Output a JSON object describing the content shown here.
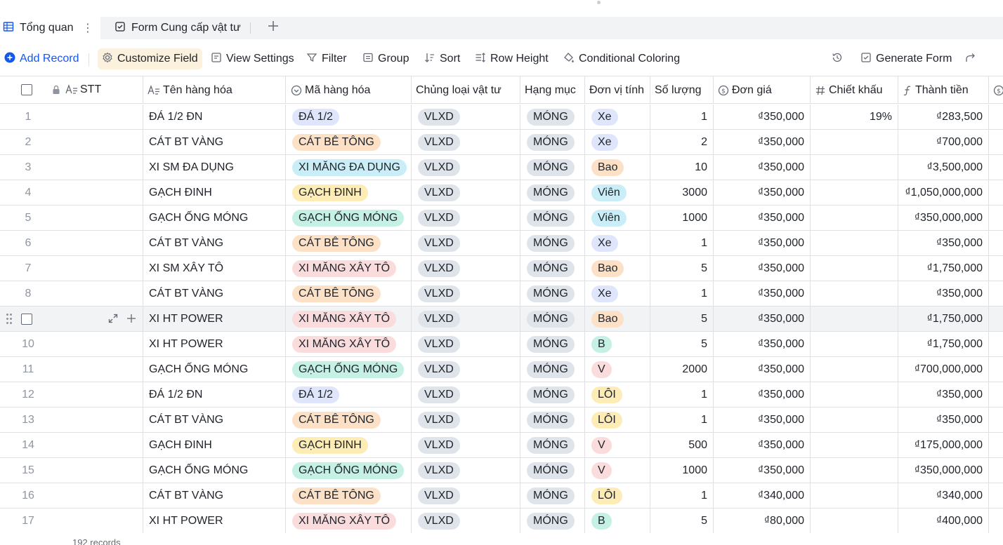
{
  "tabs": {
    "active_label": "Tổng quan",
    "second_label": "Form Cung cấp vật tư"
  },
  "toolbar": {
    "add_record": "Add Record",
    "customize_field": "Customize Field",
    "view_settings": "View Settings",
    "filter": "Filter",
    "group": "Group",
    "sort": "Sort",
    "row_height": "Row Height",
    "conditional_coloring": "Conditional Coloring",
    "generate_form": "Generate Form"
  },
  "columns": {
    "stt": "STT",
    "ten_hang_hoa": "Tên hàng hóa",
    "ma_hang_hoa": "Mã hàng hóa",
    "chung_loai": "Chủng loại vật tư",
    "hang_muc": "Hạng mục",
    "don_vi_tinh": "Đơn vị tính",
    "so_luong": "Số lượng",
    "don_gia": "Đơn giá",
    "chiet_khau": "Chiết khấu",
    "thanh_tien": "Thành tiền"
  },
  "tag_colors": {
    "ĐÁ 1/2": "#dfe6fb",
    "CÁT BÊ TÔNG": "#fde1c7",
    "XI MĂNG ĐA DỤNG": "#c9eef7",
    "GẠCH ĐINH": "#fdecb5",
    "GẠCH ỐNG MÓNG": "#c5f0e4",
    "XI MĂNG XÂY TÔ": "#fbdcdc",
    "VLXD": "#dfe3ea",
    "MÓNG": "#dfe3ea",
    "Xe": "#dfe6fb",
    "Bao": "#fde1c7",
    "Viên": "#c9eef7",
    "B": "#c5f0e4",
    "V": "#fbdcdc",
    "LÔI": "#fdecb5"
  },
  "rows": [
    {
      "idx": "1",
      "ten": "ĐÁ 1/2 ĐN",
      "ma": "ĐÁ 1/2",
      "loai": "VLXD",
      "hang_muc": "MÓNG",
      "dvt": "Xe",
      "sl": "1",
      "don_gia": "₫350,000",
      "ck": "19%",
      "thanh_tien": "₫283,500"
    },
    {
      "idx": "2",
      "ten": "CÁT BT VÀNG",
      "ma": "CÁT BÊ TÔNG",
      "loai": "VLXD",
      "hang_muc": "MÓNG",
      "dvt": "Xe",
      "sl": "2",
      "don_gia": "₫350,000",
      "ck": "",
      "thanh_tien": "₫700,000"
    },
    {
      "idx": "3",
      "ten": "XI SM ĐA DỤNG",
      "ma": "XI MĂNG ĐA DỤNG",
      "loai": "VLXD",
      "hang_muc": "MÓNG",
      "dvt": "Bao",
      "sl": "10",
      "don_gia": "₫350,000",
      "ck": "",
      "thanh_tien": "₫3,500,000"
    },
    {
      "idx": "4",
      "ten": "GẠCH ĐINH",
      "ma": "GẠCH ĐINH",
      "loai": "VLXD",
      "hang_muc": "MÓNG",
      "dvt": "Viên",
      "sl": "3000",
      "don_gia": "₫350,000",
      "ck": "",
      "thanh_tien": "₫1,050,000,000"
    },
    {
      "idx": "5",
      "ten": "GẠCH ỐNG MÓNG",
      "ma": "GẠCH ỐNG MÓNG",
      "loai": "VLXD",
      "hang_muc": "MÓNG",
      "dvt": "Viên",
      "sl": "1000",
      "don_gia": "₫350,000",
      "ck": "",
      "thanh_tien": "₫350,000,000"
    },
    {
      "idx": "6",
      "ten": "CÁT BT VÀNG",
      "ma": "CÁT BÊ TÔNG",
      "loai": "VLXD",
      "hang_muc": "MÓNG",
      "dvt": "Xe",
      "sl": "1",
      "don_gia": "₫350,000",
      "ck": "",
      "thanh_tien": "₫350,000"
    },
    {
      "idx": "7",
      "ten": "XI SM XÂY TÔ",
      "ma": "XI MĂNG XÂY TÔ",
      "loai": "VLXD",
      "hang_muc": "MÓNG",
      "dvt": "Bao",
      "sl": "5",
      "don_gia": "₫350,000",
      "ck": "",
      "thanh_tien": "₫1,750,000"
    },
    {
      "idx": "8",
      "ten": "CÁT BT VÀNG",
      "ma": "CÁT BÊ TÔNG",
      "loai": "VLXD",
      "hang_muc": "MÓNG",
      "dvt": "Xe",
      "sl": "1",
      "don_gia": "₫350,000",
      "ck": "",
      "thanh_tien": "₫350,000"
    },
    {
      "idx": "",
      "ten": "XI HT POWER",
      "ma": "XI MĂNG XÂY TÔ",
      "loai": "VLXD",
      "hang_muc": "MÓNG",
      "dvt": "Bao",
      "sl": "5",
      "don_gia": "₫350,000",
      "ck": "",
      "thanh_tien": "₫1,750,000",
      "hover": true
    },
    {
      "idx": "10",
      "ten": "XI HT POWER",
      "ma": "XI MĂNG XÂY TÔ",
      "loai": "VLXD",
      "hang_muc": "MÓNG",
      "dvt": "B",
      "sl": "5",
      "don_gia": "₫350,000",
      "ck": "",
      "thanh_tien": "₫1,750,000"
    },
    {
      "idx": "11",
      "ten": "GẠCH ỐNG MÓNG",
      "ma": "GẠCH ỐNG MÓNG",
      "loai": "VLXD",
      "hang_muc": "MÓNG",
      "dvt": "V",
      "sl": "2000",
      "don_gia": "₫350,000",
      "ck": "",
      "thanh_tien": "₫700,000,000"
    },
    {
      "idx": "12",
      "ten": "ĐÁ 1/2 ĐN",
      "ma": "ĐÁ 1/2",
      "loai": "VLXD",
      "hang_muc": "MÓNG",
      "dvt": "LÔI",
      "sl": "1",
      "don_gia": "₫350,000",
      "ck": "",
      "thanh_tien": "₫350,000"
    },
    {
      "idx": "13",
      "ten": "CÁT BT VÀNG",
      "ma": "CÁT BÊ TÔNG",
      "loai": "VLXD",
      "hang_muc": "MÓNG",
      "dvt": "LÔI",
      "sl": "1",
      "don_gia": "₫350,000",
      "ck": "",
      "thanh_tien": "₫350,000"
    },
    {
      "idx": "14",
      "ten": "GẠCH ĐINH",
      "ma": "GẠCH ĐINH",
      "loai": "VLXD",
      "hang_muc": "MÓNG",
      "dvt": "V",
      "sl": "500",
      "don_gia": "₫350,000",
      "ck": "",
      "thanh_tien": "₫175,000,000"
    },
    {
      "idx": "15",
      "ten": "GẠCH ỐNG MÓNG",
      "ma": "GẠCH ỐNG MÓNG",
      "loai": "VLXD",
      "hang_muc": "MÓNG",
      "dvt": "V",
      "sl": "1000",
      "don_gia": "₫350,000",
      "ck": "",
      "thanh_tien": "₫350,000,000"
    },
    {
      "idx": "16",
      "ten": "CÁT BT VÀNG",
      "ma": "CÁT BÊ TÔNG",
      "loai": "VLXD",
      "hang_muc": "MÓNG",
      "dvt": "LÔI",
      "sl": "1",
      "don_gia": "₫340,000",
      "ck": "",
      "thanh_tien": "₫340,000"
    },
    {
      "idx": "17",
      "ten": "XI HT POWER",
      "ma": "XI MĂNG XÂY TÔ",
      "loai": "VLXD",
      "hang_muc": "MÓNG",
      "dvt": "B",
      "sl": "5",
      "don_gia": "₫80,000",
      "ck": "",
      "thanh_tien": "₫400,000"
    }
  ],
  "footer": {
    "records": "192 records"
  }
}
